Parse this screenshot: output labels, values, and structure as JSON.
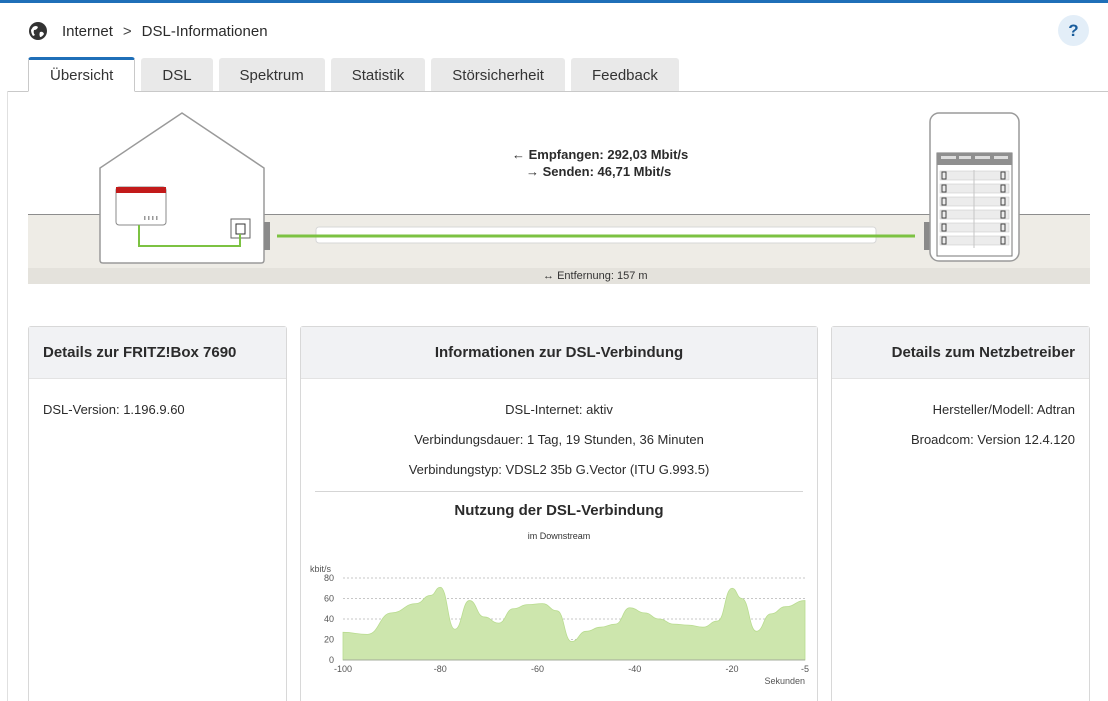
{
  "breadcrumb": {
    "section": "Internet",
    "page": "DSL-Informationen",
    "separator": ">"
  },
  "help": {
    "label": "?"
  },
  "tabs": [
    {
      "label": "Übersicht",
      "active": true
    },
    {
      "label": "DSL",
      "active": false
    },
    {
      "label": "Spektrum",
      "active": false
    },
    {
      "label": "Statistik",
      "active": false
    },
    {
      "label": "Störsicherheit",
      "active": false
    },
    {
      "label": "Feedback",
      "active": false
    }
  ],
  "diagram": {
    "receive": "Empfangen: 292,03 Mbit/s",
    "send": "Senden: 46,71 Mbit/s",
    "receive_arrow": "←",
    "send_arrow": "→",
    "distance_arrow": "↔",
    "distance": "Entfernung: 157 m"
  },
  "box_details": {
    "title": "Details zur FRITZ!Box 7690",
    "dsl_version": "DSL-Version: 1.196.9.60"
  },
  "connection": {
    "title": "Informationen zur DSL-Verbindung",
    "status": "DSL-Internet: aktiv",
    "duration": "Verbindungsdauer: 1 Tag, 19 Stunden, 36 Minuten",
    "type": "Verbindungstyp: VDSL2 35b G.Vector (ITU G.993.5)",
    "usage_title": "Nutzung der DSL-Verbindung",
    "usage_subtitle": "im Downstream"
  },
  "provider": {
    "title": "Details zum Netzbetreiber",
    "vendor": "Hersteller/Modell: Adtran",
    "broadcom": "Broadcom: Version 12.4.120"
  },
  "colors": {
    "accent": "#1f6fb8",
    "line_green": "#7cc242",
    "fill_green": "#cde6ad",
    "router_red": "#c21a1a"
  },
  "chart_data": {
    "type": "area",
    "ylabel": "kbit/s",
    "xlabel": "Sekunden",
    "ylim": [
      0,
      80
    ],
    "xlim": [
      -100,
      -5
    ],
    "yticks": [
      0,
      20,
      40,
      60,
      80
    ],
    "xticks": [
      -100,
      -80,
      -60,
      -40,
      -20,
      -5
    ],
    "grid": true,
    "x": [
      -100,
      -95,
      -90,
      -85,
      -82,
      -80,
      -77,
      -74,
      -71,
      -68,
      -65,
      -62,
      -59,
      -56,
      -53,
      -50,
      -47,
      -44,
      -41,
      -38,
      -35,
      -32,
      -29,
      -26,
      -23,
      -20,
      -18,
      -15,
      -12,
      -9,
      -5
    ],
    "values": [
      27,
      25,
      46,
      55,
      63,
      71,
      30,
      58,
      42,
      36,
      50,
      54,
      55,
      48,
      18,
      28,
      32,
      35,
      51,
      46,
      40,
      35,
      34,
      32,
      38,
      70,
      60,
      28,
      45,
      52,
      58
    ]
  }
}
